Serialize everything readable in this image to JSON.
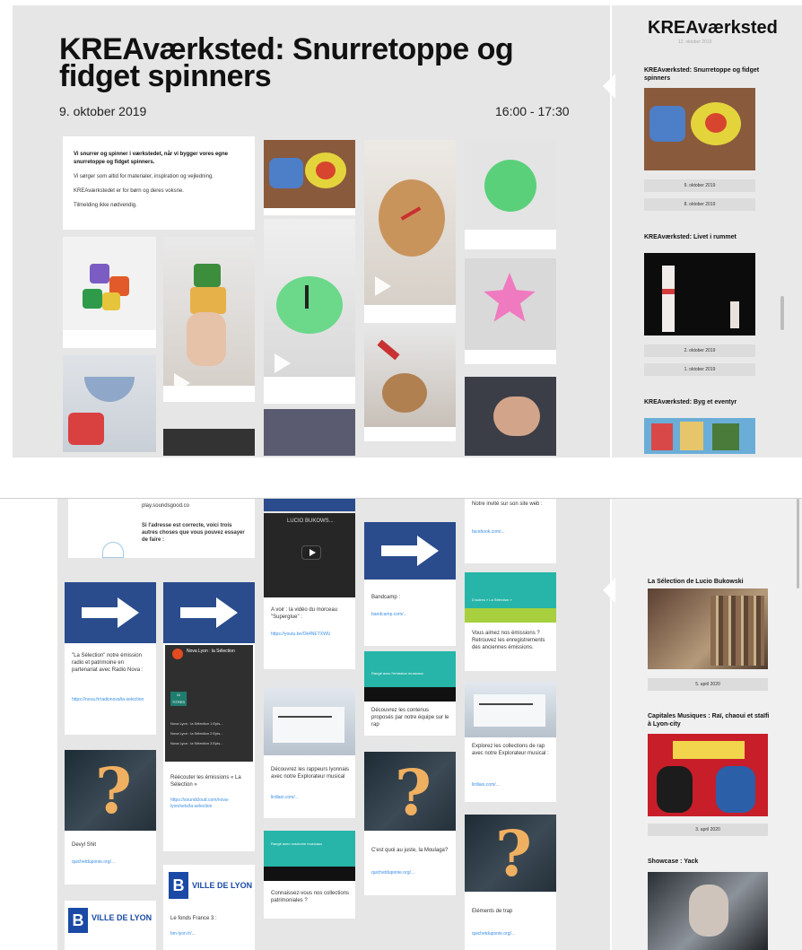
{
  "top": {
    "title": "KREAværksted: Snurretoppe og fidget spinners",
    "date": "9. oktober 2019",
    "time": "16:00 - 17:30",
    "description": [
      "Vi snurrer og spinner i værkstedet, når vi bygger vores egne snurretoppe og fidget spinners.",
      "Vi sørger som altid for materialer, inspiration og vejledning.",
      "KREAværkstedet er for børn og deres voksne.",
      "Tilmelding ikke nødvendig."
    ],
    "sidebar": {
      "brand": "KREAværksted",
      "brand_sub": "12. oktober 2019",
      "items": [
        {
          "title": "KREAværksted: Snurretoppe og fidget spinners",
          "dates": [
            "9. oktober 2019",
            "8. oktober 2019"
          ]
        },
        {
          "title": "KREAværksted: Livet i rummet",
          "dates": [
            "2. oktober 2019",
            "1. oktober 2019"
          ]
        },
        {
          "title": "KREAværksted: Byg et eventyr",
          "dates": []
        }
      ]
    }
  },
  "bottom": {
    "col1": {
      "top_card_url": "play.soundsgood.co",
      "top_card_text": "Si l'adresse est correcte, voici trois autres choses que vous pouvez essayer de faire :",
      "card1_text": "\"La Sélection\" notre émission radio et patrimoine en partenariat avec Radio Nova :",
      "card1_link": "https://nova.fr/radionova/la-selection",
      "card2_text": "Devyl Shit",
      "card2_link": "quichetduponie.org/...",
      "logo_text": "VILLE DE LYON"
    },
    "col2": {
      "player_title": "Nova Lyon : la Sélection",
      "player_badge": "11 TITRES",
      "playlist": [
        "Nova Lyon : la Sélection 1 Epis...",
        "Nova Lyon : la Sélection 2 Epis...",
        "Nova Lyon : la Sélection 3 Epis..."
      ],
      "card_text": "Réécouter les émissions « La Sélection »",
      "card_link": "https://soundcloud.com/nova-lyon/sets/la-selection",
      "logo_text": "VILLE DE LYON",
      "logo_card_text": "Le fonds France 3 :",
      "logo_card_link": "bm-lyon.fr/..."
    },
    "col3": {
      "video_title": "LUCIO BUKOWS...",
      "video_text": "A voir : la vidéo du morceau \"Superglue\" :",
      "video_link": "https://youtu.be/Ok4NETXWU",
      "explore_text": "Découvrez les rappeurs lyonnais avec notre Explorateur musical",
      "explore_link": "lirdlaoi.com/...",
      "banner_text": "Rangé avec nos/notre musicaux",
      "banner_card_text": "Connaissez-vous nos collections patrimoniales ?"
    },
    "col4": {
      "bandcamp_text": "Bandcamp :",
      "bandcamp_link": "bandcamp.com/...",
      "banner_text": "Rangé avec l'émission musicaux",
      "banner_card_text": "Découvrez les contenus proposés par notre équipe sur le rap",
      "card_text": "C'est quoi au juste, la Moulaga?",
      "card_link": "quichetduponie.org/..."
    },
    "col5": {
      "site_text": "Notre invité sur son site web :",
      "site_link": "facebook.com/...",
      "banner_text": "D'autres « La Sélection »",
      "banner_card_text": "Vous aimez nos émissions ? Retrouvez les enregistrements des anciennes émissions.",
      "explore_text": "Explorez les collections de rap avec notre Explorateur musical :",
      "explore_link": "lirdlaoi.com/...",
      "last_text": "Eléments de trap",
      "last_link": "quichetduponie.org/..."
    },
    "sidebar": {
      "items": [
        {
          "title": "La Sélection de Lucio Bukowski",
          "dates": [
            "5. april 2020"
          ]
        },
        {
          "title": "Capitales Musiques : Raï, chaoui et staïfi à Lyon-city",
          "dates": [
            "3. april 2020"
          ]
        },
        {
          "title": "Showcase : Yack",
          "dates": []
        }
      ]
    }
  },
  "colors": {
    "accent_blue": "#2a4c8c",
    "teal": "#26b5a8",
    "link": "#3a8ee6",
    "bg": "#e6e6e6"
  }
}
